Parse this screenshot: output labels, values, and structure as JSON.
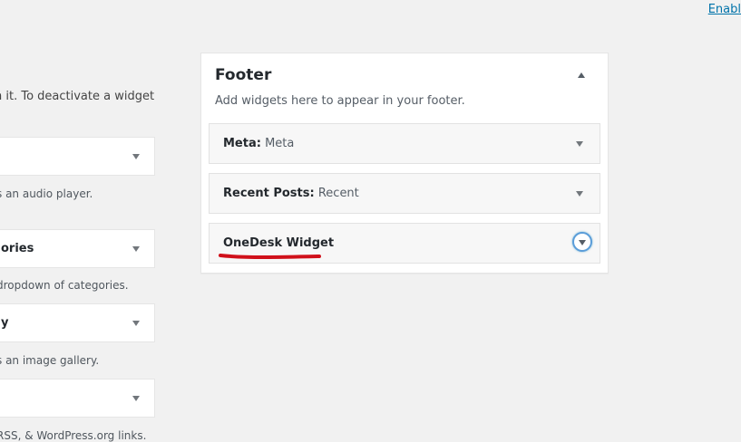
{
  "header": {
    "enable_link": "Enable"
  },
  "available": {
    "intro": "n it. To deactivate a widget",
    "widgets": [
      {
        "title": "",
        "desc": "s an audio player."
      },
      {
        "title": "ories",
        "desc": "dropdown of categories."
      },
      {
        "title": "y",
        "desc": "s an image gallery."
      },
      {
        "title": "",
        "desc": "RSS, & WordPress.org links."
      }
    ]
  },
  "sidebar": {
    "title": "Footer",
    "description": "Add widgets here to appear in your footer.",
    "widgets": [
      {
        "name": "Meta",
        "sep": ":",
        "instance": "Meta"
      },
      {
        "name": "Recent Posts",
        "sep": ":",
        "instance": "Recent"
      },
      {
        "name": "OneDesk Widget",
        "sep": "",
        "instance": ""
      }
    ]
  },
  "colors": {
    "background": "#f1f1f1",
    "link": "#0073aa",
    "focus_ring": "#5b9dd9",
    "annotation": "#d0101a"
  },
  "icons": {
    "collapse": "triangle-up-icon",
    "expand": "triangle-down-icon"
  }
}
